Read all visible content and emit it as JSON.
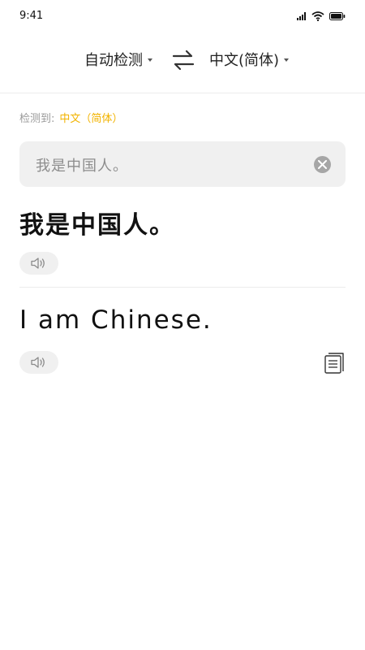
{
  "status": {
    "time": "9:41"
  },
  "languages": {
    "source": "自动检测",
    "target": "中文(简体)"
  },
  "detected": {
    "label": "检测到:",
    "language": "中文（简体）"
  },
  "input": {
    "value": "我是中国人。"
  },
  "source_display": "我是中国人。",
  "translation": "I am Chinese.",
  "icons": {
    "swap": "swap-arrows-icon",
    "clear": "clear-circle-icon",
    "speaker": "speaker-icon",
    "copy": "copy-document-icon"
  },
  "colors": {
    "accent": "#f2b300",
    "input_bg": "#f0f0f0",
    "muted_text": "#9a9a9a"
  }
}
